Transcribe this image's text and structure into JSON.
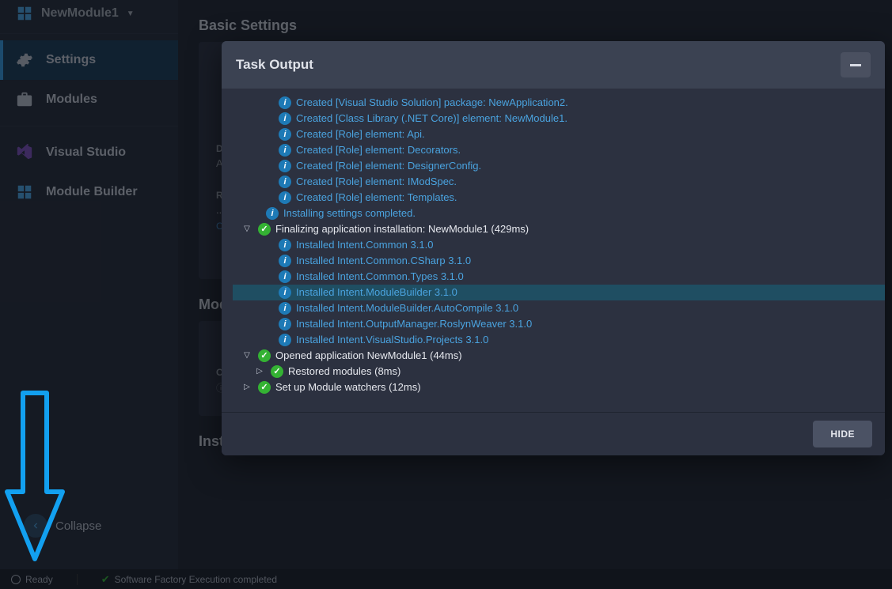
{
  "sidebar": {
    "project_name": "NewModule1",
    "items": [
      {
        "label": "Settings",
        "icon": "gear-icon",
        "active": true
      },
      {
        "label": "Modules",
        "icon": "modules-icon",
        "active": false
      }
    ],
    "designers": [
      {
        "label": "Visual Studio",
        "icon": "visualstudio-icon"
      },
      {
        "label": "Module Builder",
        "icon": "modulebuilder-icon"
      }
    ],
    "collapse_label": "Collapse"
  },
  "main": {
    "basic_title": "Basic Settings",
    "desc_label": "Description",
    "desc_placeholder": "Add a description",
    "rel_label": "Relative Output Location:",
    "rel_value": "../..",
    "abs_prefix": "C:\\D",
    "modules_title": "Mod",
    "create_label": "Create",
    "installed_title": "Installed Designers"
  },
  "status": {
    "ready_label": "Ready",
    "sf_label": "Software Factory Execution completed"
  },
  "modal": {
    "title": "Task Output",
    "hide_label": "HIDE",
    "lines": [
      {
        "level": 1,
        "icon": "info",
        "style": "link",
        "text": "Created [Visual Studio Solution] package: NewApplication2."
      },
      {
        "level": 1,
        "icon": "info",
        "style": "link",
        "text": "Created [Class Library (.NET Core)] element: NewModule1."
      },
      {
        "level": 1,
        "icon": "info",
        "style": "link",
        "text": "Created [Role] element: Api."
      },
      {
        "level": 1,
        "icon": "info",
        "style": "link",
        "text": "Created [Role] element: Decorators."
      },
      {
        "level": 1,
        "icon": "info",
        "style": "link",
        "text": "Created [Role] element: DesignerConfig."
      },
      {
        "level": 1,
        "icon": "info",
        "style": "link",
        "text": "Created [Role] element: IModSpec."
      },
      {
        "level": 1,
        "icon": "info",
        "style": "link",
        "text": "Created [Role] element: Templates."
      },
      {
        "level": 1,
        "icon": "info",
        "style": "link",
        "text": "Installing settings completed.",
        "noindent": true
      },
      {
        "level": 3,
        "chev": "down",
        "icon": "success",
        "style": "white",
        "text": "Finalizing application installation: NewModule1 (429ms)"
      },
      {
        "level": 1,
        "icon": "info",
        "style": "link",
        "text": "Installed Intent.Common 3.1.0"
      },
      {
        "level": 1,
        "icon": "info",
        "style": "link",
        "text": "Installed Intent.Common.CSharp 3.1.0"
      },
      {
        "level": 1,
        "icon": "info",
        "style": "link",
        "text": "Installed Intent.Common.Types 3.1.0"
      },
      {
        "level": 1,
        "icon": "info",
        "style": "link",
        "text": "Installed Intent.ModuleBuilder 3.1.0",
        "highlight": true
      },
      {
        "level": 1,
        "icon": "info",
        "style": "link",
        "text": "Installed Intent.ModuleBuilder.AutoCompile 3.1.0"
      },
      {
        "level": 1,
        "icon": "info",
        "style": "link",
        "text": "Installed Intent.OutputManager.RoslynWeaver 3.1.0"
      },
      {
        "level": 1,
        "icon": "info",
        "style": "link",
        "text": "Installed Intent.VisualStudio.Projects 3.1.0"
      },
      {
        "level": 3,
        "chev": "down",
        "icon": "success",
        "style": "white",
        "text": "Opened application NewModule1 (44ms)"
      },
      {
        "level": 2,
        "chev": "right",
        "icon": "success",
        "style": "white",
        "text": "Restored modules (8ms)"
      },
      {
        "level": 3,
        "chev": "right",
        "icon": "success",
        "style": "white",
        "text": "Set up Module watchers (12ms)"
      }
    ]
  }
}
